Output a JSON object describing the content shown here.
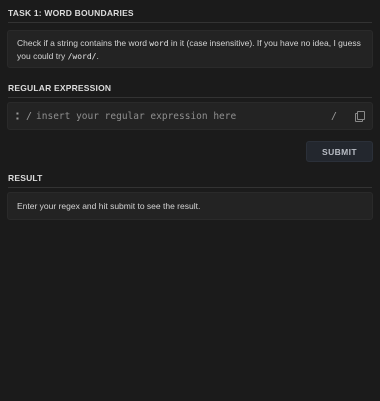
{
  "task": {
    "title": "TASK 1: WORD BOUNDARIES",
    "description_part1": "Check if a string contains the word ",
    "description_code1": "word",
    "description_part2": " in it (case insensitive). If you have no idea, I guess you could try ",
    "description_code2": "/word/",
    "description_part3": "."
  },
  "regex": {
    "section_title": "REGULAR EXPRESSION",
    "flag_icon": "flags-icon",
    "open_slash": "/",
    "placeholder": "insert your regular expression here",
    "value": "",
    "close_slash": "/",
    "copy_icon": "copy-icon"
  },
  "submit": {
    "label": "SUBMIT"
  },
  "result": {
    "section_title": "RESULT",
    "text": "Enter your regex and hit submit to see the result."
  }
}
